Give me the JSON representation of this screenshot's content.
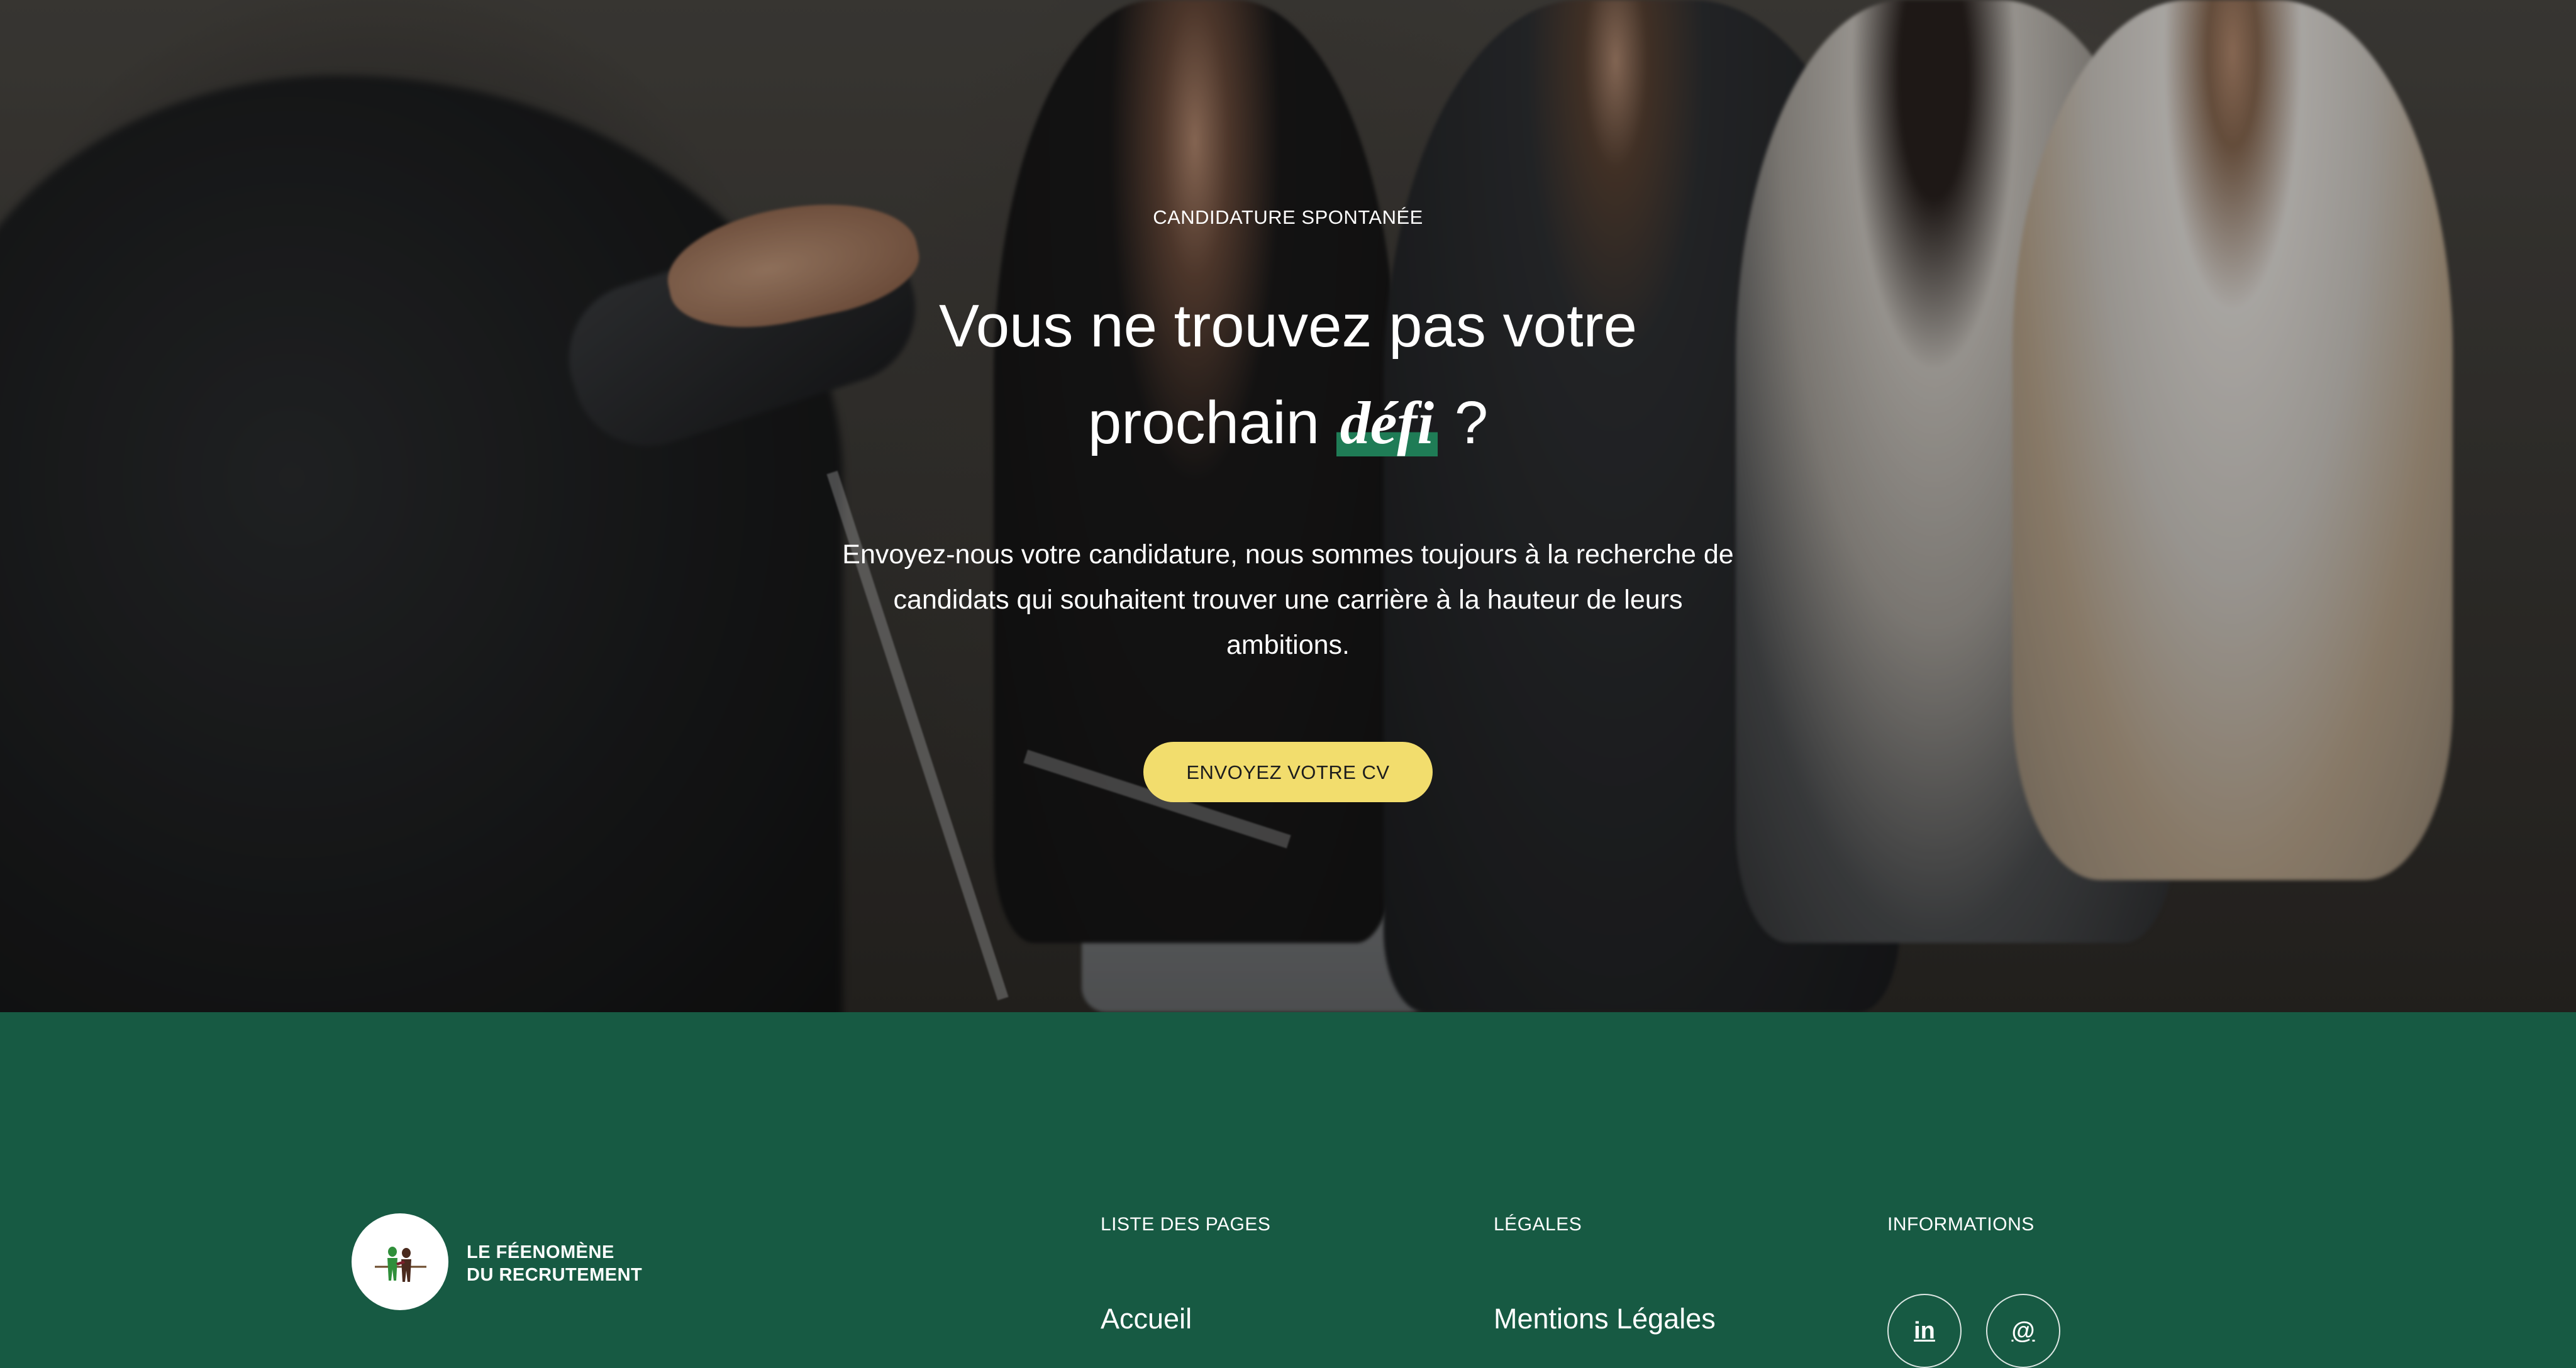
{
  "hero": {
    "eyebrow": "CANDIDATURE SPONTANÉE",
    "title_line1": "Vous ne trouvez pas votre",
    "title_line2_prefix": "prochain ",
    "title_accent": "défi",
    "title_line2_suffix": " ?",
    "description": "Envoyez-nous votre candidature, nous sommes toujours à la recherche de candidats qui souhaitent trouver une carrière à la hauteur de leurs ambitions.",
    "cta_label": "ENVOYEZ VOTRE CV"
  },
  "footer": {
    "logo": {
      "line1": "LE FÉENOMÈNE",
      "line2": "DU RECRUTEMENT"
    },
    "columns": [
      {
        "title": "LISTE DES PAGES",
        "link": "Accueil"
      },
      {
        "title": "LÉGALES",
        "link": "Mentions Légales"
      },
      {
        "title": "INFORMATIONS"
      }
    ],
    "social": {
      "linkedin_label": "in",
      "email_label": "@"
    }
  },
  "colors": {
    "footer_bg": "#175a43",
    "cta_bg": "#f2dd6d",
    "accent_highlight": "#1f7c56"
  }
}
